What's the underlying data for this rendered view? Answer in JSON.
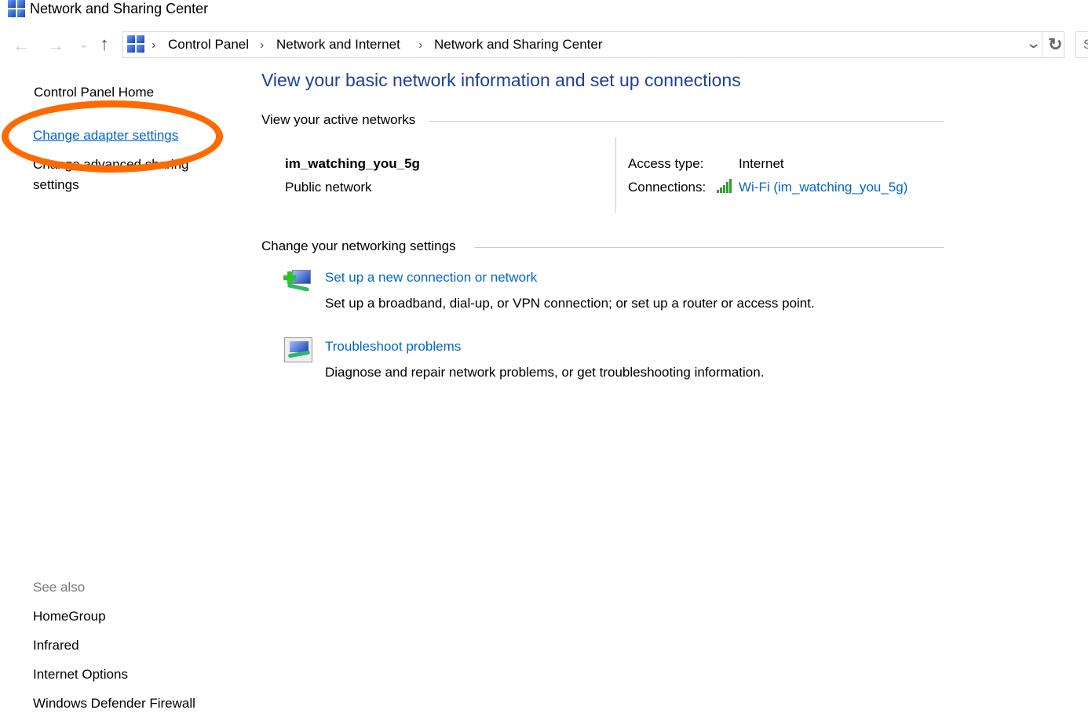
{
  "window": {
    "title": "Network and Sharing Center"
  },
  "nav": {
    "back": "←",
    "forward": "→",
    "recent": "⌄",
    "up": "↑",
    "refresh": "↻",
    "search_placeholder": "S"
  },
  "breadcrumb": [
    "Control Panel",
    "Network and Internet",
    "Network and Sharing Center"
  ],
  "sidebar": {
    "items": [
      {
        "label": "Control Panel Home"
      },
      {
        "label": "Change adapter settings"
      },
      {
        "label": "Change advanced sharing"
      },
      {
        "label": "settings"
      }
    ],
    "see_also_label": "See also",
    "see_also": [
      {
        "label": "HomeGroup"
      },
      {
        "label": "Infrared"
      },
      {
        "label": "Internet Options"
      },
      {
        "label": "Windows Defender Firewall"
      }
    ]
  },
  "main": {
    "title": "View your basic network information and set up connections",
    "active_heading": "View your active networks",
    "network": {
      "name": "im_watching_you_5g",
      "type": "Public network",
      "access_label": "Access type:",
      "access_value": "Internet",
      "connections_label": "Connections:",
      "connection_link": "Wi-Fi (im_watching_you_5g)"
    },
    "settings_heading": "Change your networking settings",
    "tasks": [
      {
        "link": "Set up a new connection or network",
        "desc": "Set up a broadband, dial-up, or VPN connection; or set up a router or access point.",
        "icon": "new-connection-icon"
      },
      {
        "link": "Troubleshoot problems",
        "desc": "Diagnose and repair network problems, or get troubleshooting information.",
        "icon": "troubleshoot-icon"
      }
    ]
  },
  "annotation": {
    "color": "#ff6a00"
  },
  "colors": {
    "link": "#0066cc",
    "title": "#1e3f9a"
  }
}
